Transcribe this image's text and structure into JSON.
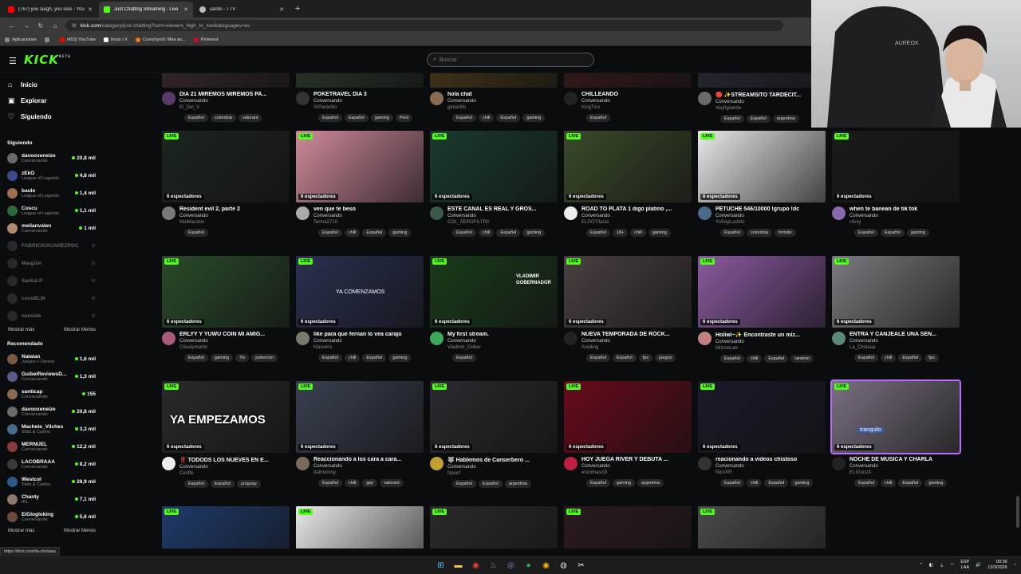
{
  "browser": {
    "tabs": [
      {
        "title": "(767) you laugh, you lose - You",
        "favicon_color": "#ff0000",
        "active": false
      },
      {
        "title": "Just Chatting Streaming - Live",
        "favicon_color": "#53fc18",
        "active": true
      },
      {
        "title": "santxi - TTV",
        "favicon_color": "#bbbbbb",
        "active": false
      }
    ],
    "new_tab": "+",
    "url_host": "kick.com",
    "url_path": "/category/just-chatting?sort=viewers_high_to_low&languages=es",
    "bookmarks": [
      {
        "label": "Aplicaciones",
        "color": "#888888"
      },
      {
        "label": "",
        "color": "#888888"
      },
      {
        "label": "(453) YouTube",
        "color": "#ff0000"
      },
      {
        "label": "Inicio / X",
        "color": "#ffffff"
      },
      {
        "label": "Crunchyroll: Mira an...",
        "color": "#f47521"
      },
      {
        "label": "Pinterest",
        "color": "#e60023"
      }
    ],
    "status_url": "https://kick.com/la-cholaaa"
  },
  "header": {
    "logo": "KICK",
    "logo_badge": "BETA",
    "search_placeholder": "Buscar"
  },
  "sidebar": {
    "nav": [
      {
        "label": "Inicio",
        "icon": "home-icon",
        "glyph": "⌂"
      },
      {
        "label": "Explorar",
        "icon": "compass-icon",
        "glyph": "▣"
      },
      {
        "label": "Siguiendo",
        "icon": "heart-icon",
        "glyph": "♡"
      }
    ],
    "following_title": "Siguiendo",
    "following": [
      {
        "name": "davooxeneize",
        "cat": "Conversando",
        "viewers": "20,8 mil",
        "color": "#6a6a6a",
        "online": true
      },
      {
        "name": "zEkO",
        "cat": "League of Legends",
        "viewers": "4,8 mil",
        "color": "#3a4a8a",
        "online": true
      },
      {
        "name": "baulo",
        "cat": "League of Legends",
        "viewers": "1,4 mil",
        "color": "#a07050",
        "online": true
      },
      {
        "name": "Coscu",
        "cat": "League of Legends",
        "viewers": "1,1 mil",
        "color": "#2b6b3a",
        "online": true
      },
      {
        "name": "melianvalen",
        "cat": "Conversando",
        "viewers": "1 mil",
        "color": "#b08a70",
        "online": true
      },
      {
        "name": "FABRICIOSUAREZPDC",
        "cat": "",
        "viewers": "",
        "color": "#555555",
        "online": false
      },
      {
        "name": "Margiiin",
        "cat": "",
        "viewers": "",
        "color": "#555555",
        "online": false
      },
      {
        "name": "SantuLP",
        "cat": "",
        "viewers": "",
        "color": "#555555",
        "online": false
      },
      {
        "name": "cocoBLM",
        "cat": "",
        "viewers": "",
        "color": "#555555",
        "online": false
      },
      {
        "name": "nanside",
        "cat": "",
        "viewers": "",
        "color": "#555555",
        "online": false
      }
    ],
    "show_more": "Mostrar más",
    "show_less": "Mostrar Menos",
    "recommended_title": "Recomendado",
    "recommended": [
      {
        "name": "Natalan",
        "cat": "Juegos + Demos",
        "viewers": "1,6 mil",
        "color": "#7a5a40"
      },
      {
        "name": "GuibelReviewsD...",
        "cat": "Conversando",
        "viewers": "1,3 mil",
        "color": "#5a5a8a"
      },
      {
        "name": "santicap",
        "cat": "Conversando",
        "viewers": "155",
        "color": "#8a6a50"
      },
      {
        "name": "davooxeneize",
        "cat": "Conversando",
        "viewers": "20,8 mil",
        "color": "#6a6a6a"
      },
      {
        "name": "Machete_Vilches",
        "cat": "Slots & Casino",
        "viewers": "3,3 mil",
        "color": "#4a6a8a"
      },
      {
        "name": "MERNUEL",
        "cat": "Conversando",
        "viewers": "12,2 mil",
        "color": "#8a3a3a"
      },
      {
        "name": "LACOBRAAA",
        "cat": "Conversando",
        "viewers": "8,2 mil",
        "color": "#3a3a3a"
      },
      {
        "name": "Westcol",
        "cat": "Slots & Casino",
        "viewers": "28,9 mil",
        "color": "#2a5a8a"
      },
      {
        "name": "Chanty",
        "cat": "IRL",
        "viewers": "7,1 mil",
        "color": "#8a7a6a"
      },
      {
        "name": "ElGlogloking",
        "cat": "Conversando",
        "viewers": "5,6 mil",
        "color": "#6a4a3a"
      }
    ],
    "show_more2": "Mostrar más",
    "show_less2": "Mostrar Menos"
  },
  "cards": [
    {
      "title": "DIA 21 MIREMOS MIREMOS PA...",
      "cat": "Conversando",
      "user": "El_Del_V",
      "tags": [
        "Español",
        "colombia",
        "valorant"
      ],
      "viewers": "",
      "bg": "#3a2a2a",
      "av": "#5a3a6a",
      "partial": true
    },
    {
      "title": "POKETRAVEL DIA 3",
      "cat": "Conversando",
      "user": "SrPastelito",
      "tags": [
        "Español",
        "Español",
        "gaming",
        "Perú"
      ],
      "viewers": "",
      "bg": "#2a3a2a",
      "av": "#333333",
      "partial": true
    },
    {
      "title": "hola chat",
      "cat": "Conversando",
      "user": "genaritto",
      "tags": [
        "Español",
        "chill",
        "Español",
        "gaming"
      ],
      "viewers": "",
      "bg": "#4a3a1a",
      "av": "#8a6a50",
      "partial": true
    },
    {
      "title": "CHILLEANDO",
      "cat": "Conversando",
      "user": "KingTico",
      "tags": [
        "Español"
      ],
      "viewers": "",
      "bg": "#3a1a1a",
      "av": "#222222",
      "partial": true
    },
    {
      "title": "🔴 ✨STREAMSITO TARDECIT...",
      "cat": "Conversando",
      "user": "Alej0grande",
      "tags": [
        "Español",
        "Español",
        "argentina"
      ],
      "viewers": "",
      "bg": "#2a2a3a",
      "av": "#6a6a6a",
      "partial": true
    },
    {
      "title": "Resident evil 2, parte 2",
      "cat": "Conversando",
      "user": "MoiMarston",
      "tags": [
        "Español"
      ],
      "viewers": "6 espectadores",
      "bg": "#1c2520",
      "av": "#7a7a7a"
    },
    {
      "title": "ven que te beso",
      "cat": "Conversando",
      "user": "Terma2710",
      "tags": [
        "Español",
        "chill",
        "Español",
        "gaming"
      ],
      "viewers": "6 espectadores",
      "bg": "#d08a9a",
      "av": "#aaaaaa"
    },
    {
      "title": "ESTE CANAL ES REAL Y GROS...",
      "cat": "Conversando",
      "user": "COL_SEROFILTR0",
      "tags": [
        "Español",
        "chill",
        "Español",
        "gaming"
      ],
      "viewers": "6 espectadores",
      "bg": "#1a3a30",
      "av": "#3a5a4a"
    },
    {
      "title": "ROAD TO PLATA 1 digo platino ,...",
      "cat": "Conversando",
      "user": "ELGOTifacio",
      "tags": [
        "Español",
        "18+",
        "chill",
        "gaming"
      ],
      "viewers": "6 espectadores",
      "bg": "#3a4a2a",
      "av": "#eeeeee"
    },
    {
      "title": "PETUCHE 546/10000 !grupo !dc",
      "cat": "Conversando",
      "user": "YoSoyLuchito",
      "tags": [
        "Español",
        "colombia",
        "fortnite"
      ],
      "viewers": "6 espectadores",
      "bg": "#e8e8e8",
      "av": "#4a6a8a"
    },
    {
      "title": "when te banean de tik tok",
      "cat": "Conversando",
      "user": "r4xxy",
      "tags": [
        "Español",
        "Español",
        "gaming"
      ],
      "viewers": "6 espectadores",
      "bg": "#1a1a1a",
      "av": "#8a6aaa"
    },
    {
      "title": "ERLYY Y YUWU COIN MI AMIG...",
      "cat": "Conversando",
      "user": "Cloudymartin",
      "tags": [
        "Español",
        "gaming",
        "7tv",
        "pokemon"
      ],
      "viewers": "6 espectadores",
      "bg": "#2a4a2a",
      "av": "#aa5a7a"
    },
    {
      "title": "like para que fernan lo vea carajo",
      "cat": "Conversando",
      "user": "Manulrrs",
      "tags": [
        "Español",
        "chill",
        "Español",
        "gaming"
      ],
      "viewers": "6 espectadores",
      "bg": "#2a3050",
      "av": "#7a7a6a"
    },
    {
      "title": "My first stream.",
      "cat": "Conversando",
      "user": "Vladimir_Gober",
      "tags": [
        "Español"
      ],
      "viewers": "6 espectadores",
      "bg": "#1a3a1a",
      "av": "#3aaa5a"
    },
    {
      "title": "NUEVA TEMPORADA DE ROCK...",
      "cat": "Conversando",
      "user": "Axelkng",
      "tags": [
        "Español",
        "Español",
        "fps",
        "juegos"
      ],
      "viewers": "6 espectadores",
      "bg": "#4a4040",
      "av": "#222222"
    },
    {
      "title": "Hoiiwi~✨ Encontraste un miz...",
      "cat": "Conversando",
      "user": "MizoreLee",
      "tags": [
        "Español",
        "chill",
        "Español",
        "random"
      ],
      "viewers": "6 espectadores",
      "bg": "#8a5aa0",
      "av": "#c08080"
    },
    {
      "title": "ENTRA Y CANJEALE UNA SEN...",
      "cat": "Conversando",
      "user": "La_Cholaaa",
      "tags": [
        "Español",
        "chill",
        "Español",
        "fps"
      ],
      "viewers": "6 espectadores",
      "bg": "#7a7a80",
      "av": "#5a8a7a"
    },
    {
      "title": "‼️ TODODS LOS NUEVES EN E...",
      "cat": "Conversando",
      "user": "Cenffe",
      "tags": [
        "Español",
        "Español",
        "uruguay"
      ],
      "viewers": "6 espectadores",
      "bg": "#2a2a2a",
      "av": "#eeeeee",
      "overlay": "YA EMPEZAMOS"
    },
    {
      "title": "Reaccionando a los cara a cara...",
      "cat": "Conversando",
      "user": "dalmonroy",
      "tags": [
        "Español",
        "chill",
        "gay",
        "valorant"
      ],
      "viewers": "6 espectadores",
      "bg": "#3a4050",
      "av": "#7a6a5a"
    },
    {
      "title": "🐺 Hablemos de Canserbero ...",
      "cat": "Conversando",
      "user": "Nauef",
      "tags": [
        "Español",
        "Español",
        "argentina"
      ],
      "viewers": "6 espectadores",
      "bg": "#2a2a30",
      "av": "#c0a030"
    },
    {
      "title": "HOY JUEGA RIVER Y DEBUTA ...",
      "cat": "Conversando",
      "user": "enzomasci9",
      "tags": [
        "Español",
        "gaming",
        "argentina"
      ],
      "viewers": "6 espectadores",
      "bg": "#6a0a1a",
      "av": "#c02040"
    },
    {
      "title": "reacionando a videos chistoso",
      "cat": "Conversando",
      "user": "NicoXR",
      "tags": [
        "Español",
        "chill",
        "Español",
        "gaming"
      ],
      "viewers": "6 espectadores",
      "bg": "#1a1a2a",
      "av": "#333333"
    },
    {
      "title": "NOCHE DE MUSICA Y CHARLA",
      "cat": "Conversando",
      "user": "ELIGonzA",
      "tags": [
        "Español",
        "chill",
        "Español",
        "gaming"
      ],
      "viewers": "6 espectadores",
      "bg": "#7a7080",
      "av": "#222222"
    },
    {
      "title": "",
      "cat": "",
      "user": "",
      "tags": [],
      "viewers": "",
      "bg": "#203a6a",
      "av": "#333333"
    },
    {
      "title": "",
      "cat": "",
      "user": "",
      "tags": [],
      "viewers": "",
      "bg": "#e8e8e8",
      "av": "#333333"
    },
    {
      "title": "",
      "cat": "",
      "user": "",
      "tags": [],
      "viewers": "",
      "bg": "#2a2a2a",
      "av": "#333333"
    },
    {
      "title": "",
      "cat": "",
      "user": "",
      "tags": [],
      "viewers": "",
      "bg": "#2a1a20",
      "av": "#333333"
    },
    {
      "title": "",
      "cat": "",
      "user": "",
      "tags": [],
      "viewers": "",
      "bg": "#4a4a4a",
      "av": "#333333"
    }
  ],
  "live_label": "LIVE",
  "overlay_texts": {
    "ya_comenzamos": "YA COMENZAMOS",
    "vladimir": "VLADIMIR GOBERNADOR",
    "tranquilo": "tranquilo"
  },
  "webcam": {
    "brand": "AUREOX"
  },
  "taskbar": {
    "lang1": "ESP",
    "lang2": "LAA",
    "time": "00:36",
    "date": "12/3/2026"
  }
}
